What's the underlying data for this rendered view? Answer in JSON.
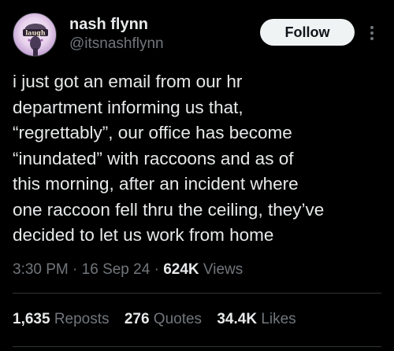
{
  "author": {
    "display_name": "nash flynn",
    "handle": "@itsnashflynn",
    "avatar_text": "laugh"
  },
  "follow_label": "Follow",
  "tweet": {
    "lines": [
      "i just got an email from our hr",
      "department informing us that,",
      "“regrettably”, our office has become",
      "“inundated” with raccoons and as of",
      "this morning, after an incident where",
      "one raccoon fell thru the ceiling, they’ve",
      "decided to let us work from home"
    ]
  },
  "meta": {
    "time": "3:30 PM",
    "sep1": "·",
    "date": "16 Sep 24",
    "sep2": "·",
    "views_count": "624K",
    "views_label": "Views"
  },
  "stats": {
    "reposts_count": "1,635",
    "reposts_label": "Reposts",
    "quotes_count": "276",
    "quotes_label": "Quotes",
    "likes_count": "34.4K",
    "likes_label": "Likes"
  },
  "colors": {
    "background": "#000000",
    "text": "#e7e9ea",
    "secondary": "#71767b",
    "follow_bg": "#eff3f4",
    "follow_text": "#0f1419",
    "divider": "#2f3336"
  },
  "icons": {
    "more": "more-horizontal-icon"
  }
}
